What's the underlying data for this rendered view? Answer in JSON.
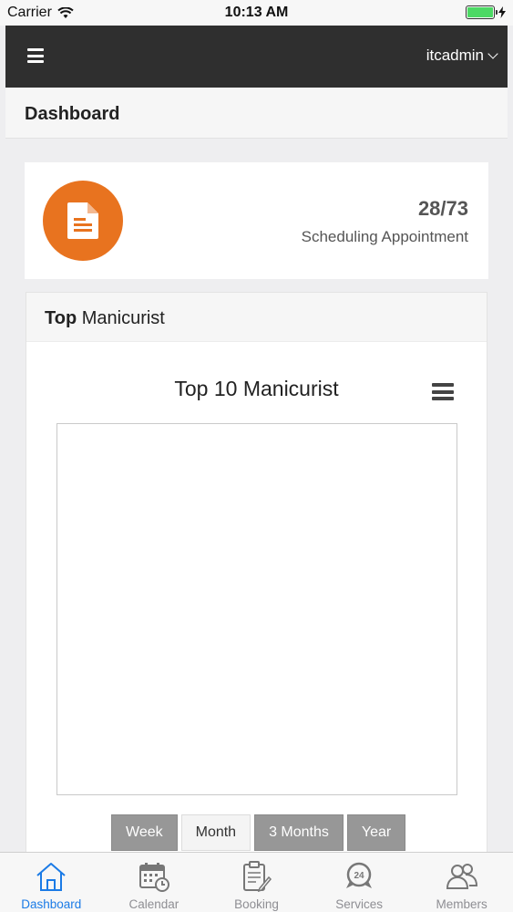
{
  "status_bar": {
    "carrier": "Carrier",
    "time": "10:13 AM"
  },
  "navbar": {
    "menu_icon": "hamburger-icon",
    "user": "itcadmin"
  },
  "page": {
    "title": "Dashboard"
  },
  "stat_card": {
    "icon": "document-icon",
    "icon_color": "#e8731f",
    "value": "28/73",
    "label": "Scheduling Appointment"
  },
  "panel": {
    "header_bold": "Top",
    "header_rest": " Manicurist",
    "chart_title": "Top 10 Manicurist",
    "chart_menu_icon": "hamburger-icon"
  },
  "range_buttons": [
    {
      "label": "Week",
      "active": false
    },
    {
      "label": "Month",
      "active": true
    },
    {
      "label": "3 Months",
      "active": false
    },
    {
      "label": "Year",
      "active": false
    }
  ],
  "tabbar": {
    "accent": "#1b7be6",
    "tabs": [
      {
        "label": "Dashboard",
        "icon": "home-icon",
        "active": true
      },
      {
        "label": "Calendar",
        "icon": "calendar-icon",
        "active": false
      },
      {
        "label": "Booking",
        "icon": "clipboard-icon",
        "active": false
      },
      {
        "label": "Services",
        "icon": "24-hours-icon",
        "active": false
      },
      {
        "label": "Members",
        "icon": "members-icon",
        "active": false
      }
    ]
  }
}
